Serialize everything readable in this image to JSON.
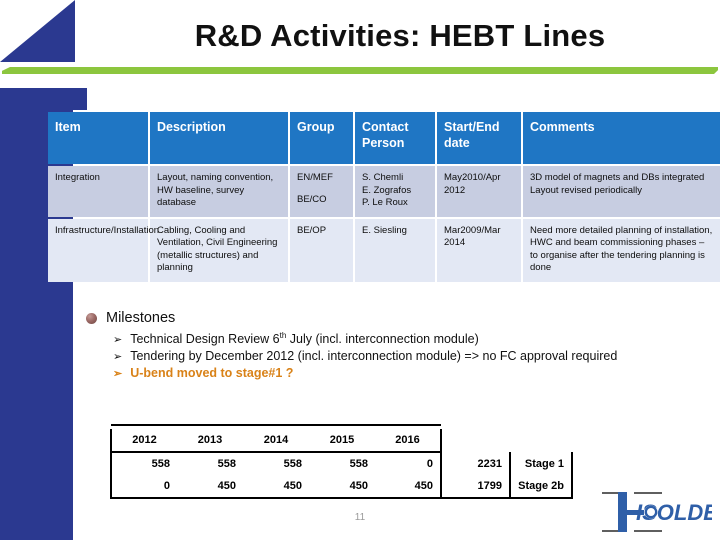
{
  "slide": {
    "title": "R&D Activities: HEBT Lines",
    "page_number": "11",
    "accent_blue": "#2b3990",
    "accent_green": "#8cc63e",
    "header_blue": "#1f76c4",
    "highlight_orange": "#d98218"
  },
  "main_table": {
    "headers": [
      "Item",
      "Description",
      "Group",
      "Contact Person",
      "Start/End date",
      "Comments"
    ],
    "rows": [
      {
        "item": "Integration",
        "description": "Layout, naming convention, HW baseline, survey database",
        "group_1": "EN/MEF",
        "group_2": "BE/CO",
        "contact_1": "S. Chemli",
        "contact_2": "E. Zografos",
        "contact_3": "P. Le Roux",
        "dates": "May2010/Apr 2012",
        "comment_1": "3D model of magnets and DBs integrated",
        "comment_2": "Layout revised periodically"
      },
      {
        "item": "Infrastructure/Installation",
        "description": "Cabling, Cooling and Ventilation, Civil Engineering (metallic structures) and planning",
        "group_1": "BE/OP",
        "group_2": "",
        "contact_1": "E. Siesling",
        "contact_2": "",
        "contact_3": "",
        "dates": "Mar2009/Mar 2014",
        "comment_1": "Need more detailed planning of installation, HWC and beam commissioning phases – to organise after the tendering planning is done",
        "comment_2": ""
      }
    ]
  },
  "milestones": {
    "heading": "Milestones",
    "items": [
      {
        "text_before": "Technical Design Review 6",
        "sup": "th",
        "text_after": " July (incl. interconnection module)",
        "highlight": false
      },
      {
        "text_before": "Tendering by December 2012 (incl. interconnection module) => no FC approval required",
        "sup": "",
        "text_after": "",
        "highlight": false
      },
      {
        "text_before": "U-bend moved to stage#1 ?",
        "sup": "",
        "text_after": "",
        "highlight": true
      }
    ],
    "arrow_glyph": "➢"
  },
  "chart_data": {
    "type": "table",
    "title": "",
    "categories": [
      "2012",
      "2013",
      "2014",
      "2015",
      "2016"
    ],
    "series": [
      {
        "name": "Stage 1",
        "values": [
          558,
          558,
          558,
          558,
          0
        ],
        "total": 2231
      },
      {
        "name": "Stage 2b",
        "values": [
          0,
          450,
          450,
          450,
          450
        ],
        "total": 1799
      }
    ]
  },
  "number_table": {
    "year_headers": [
      "2012",
      "2013",
      "2014",
      "2015",
      "2016"
    ],
    "rows": [
      {
        "values": [
          "558",
          "558",
          "558",
          "558",
          "0"
        ],
        "total": "2231",
        "label": "Stage 1"
      },
      {
        "values": [
          "0",
          "450",
          "450",
          "450",
          "450"
        ],
        "total": "1799",
        "label": "Stage 2b"
      }
    ]
  },
  "logo": {
    "name": "HIE-ISOLDE",
    "wordmark": "ISOLDE"
  }
}
